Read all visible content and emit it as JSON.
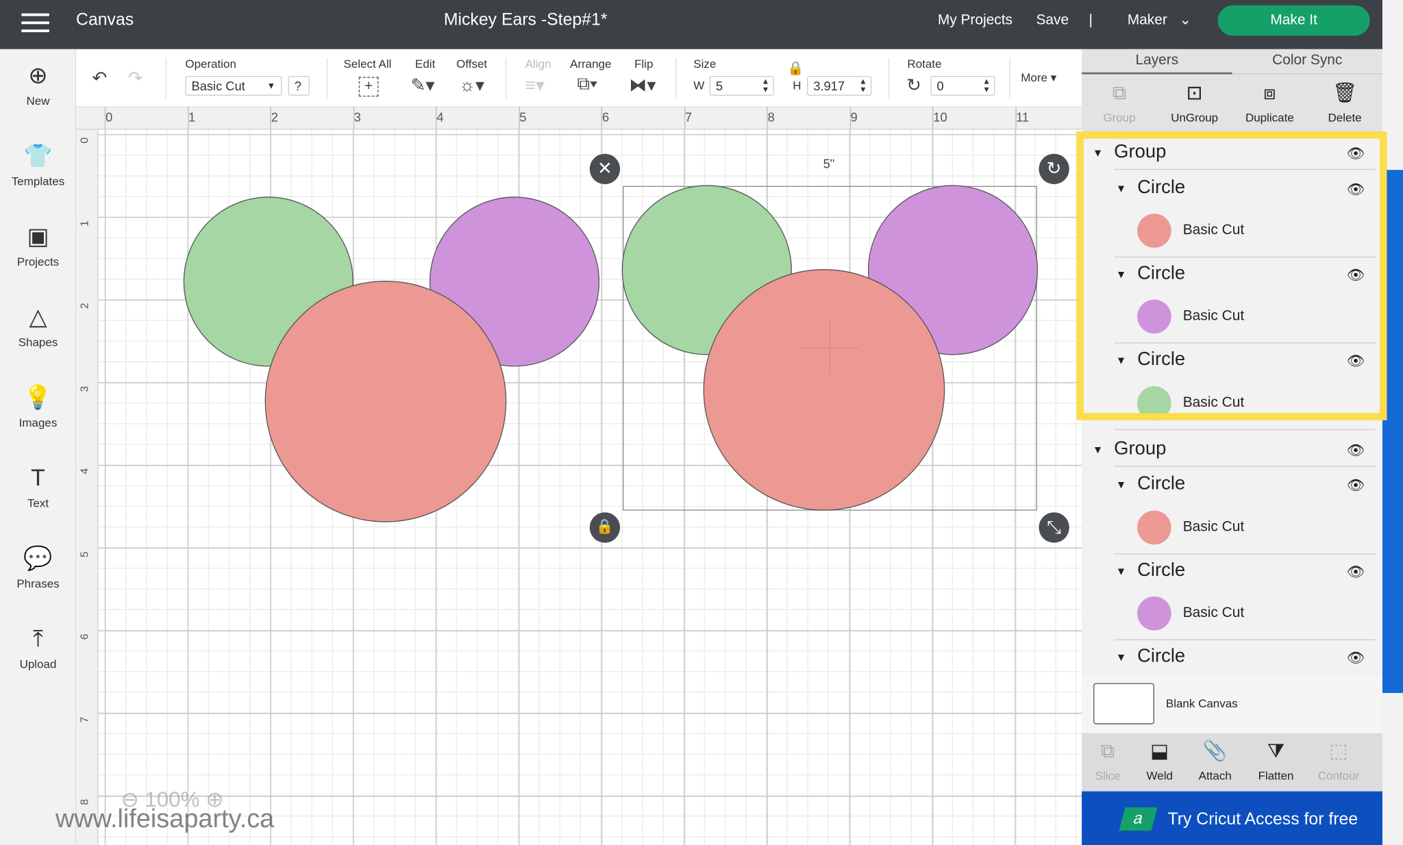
{
  "header": {
    "menu_icon": "hamburger-icon",
    "app_name": "Canvas",
    "project_title": "Mickey Ears -Step#1*",
    "my_projects": "My Projects",
    "save": "Save",
    "divider": "|",
    "machine": "Maker",
    "make_it": "Make It",
    "make_it_color": "#15a06a"
  },
  "sidebar": {
    "items": [
      {
        "label": "New",
        "icon": "⊕"
      },
      {
        "label": "Templates",
        "icon": "👕"
      },
      {
        "label": "Projects",
        "icon": "▣"
      },
      {
        "label": "Shapes",
        "icon": "△"
      },
      {
        "label": "Images",
        "icon": "💡"
      },
      {
        "label": "Text",
        "icon": "T"
      },
      {
        "label": "Phrases",
        "icon": "💬"
      },
      {
        "label": "Upload",
        "icon": "⤒"
      }
    ]
  },
  "toolbar": {
    "operation_label": "Operation",
    "operation_value": "Basic Cut",
    "help": "?",
    "select_all": "Select All",
    "edit": "Edit",
    "offset": "Offset",
    "align": "Align",
    "arrange": "Arrange",
    "flip": "Flip",
    "size": "Size",
    "w_label": "W",
    "w_value": "5",
    "h_label": "H",
    "h_value": "3.917",
    "rotate": "Rotate",
    "rotate_value": "0",
    "more": "More ▾"
  },
  "ruler": {
    "x": [
      "0",
      "1",
      "2",
      "3",
      "4",
      "5",
      "6",
      "7",
      "8",
      "9",
      "10",
      "11"
    ],
    "y": [
      "0",
      "1",
      "2",
      "3",
      "4",
      "5",
      "6",
      "7",
      "8"
    ]
  },
  "canvas": {
    "selection_width_label": "5\"",
    "colors": {
      "green": "#a5d6a3",
      "purple": "#cf93dc",
      "red": "#ec9893"
    }
  },
  "panel": {
    "tabs": [
      "Layers",
      "Color Sync"
    ],
    "actions": [
      {
        "label": "Group",
        "disabled": true
      },
      {
        "label": "UnGroup"
      },
      {
        "label": "Duplicate"
      },
      {
        "label": "Delete"
      }
    ],
    "layers": [
      {
        "type": "group",
        "label": "Group"
      },
      {
        "type": "circle",
        "label": "Circle"
      },
      {
        "type": "item",
        "label": "Basic Cut",
        "color": "#ec9893"
      },
      {
        "type": "circle",
        "label": "Circle"
      },
      {
        "type": "item",
        "label": "Basic Cut",
        "color": "#cf93dc"
      },
      {
        "type": "circle",
        "label": "Circle"
      },
      {
        "type": "item",
        "label": "Basic Cut",
        "color": "#a5d6a3"
      },
      {
        "type": "group",
        "label": "Group"
      },
      {
        "type": "circle",
        "label": "Circle"
      },
      {
        "type": "item",
        "label": "Basic Cut",
        "color": "#ec9893"
      },
      {
        "type": "circle",
        "label": "Circle"
      },
      {
        "type": "item",
        "label": "Basic Cut",
        "color": "#cf93dc"
      },
      {
        "type": "circle",
        "label": "Circle"
      }
    ],
    "blank_canvas": "Blank Canvas",
    "bottom_actions": [
      {
        "label": "Slice",
        "disabled": true
      },
      {
        "label": "Weld"
      },
      {
        "label": "Attach"
      },
      {
        "label": "Flatten"
      },
      {
        "label": "Contour",
        "disabled": true
      }
    ],
    "access_banner": "Try Cricut Access for free"
  },
  "zoom": {
    "level": "100%"
  },
  "watermark": "www.lifeisaparty.ca"
}
